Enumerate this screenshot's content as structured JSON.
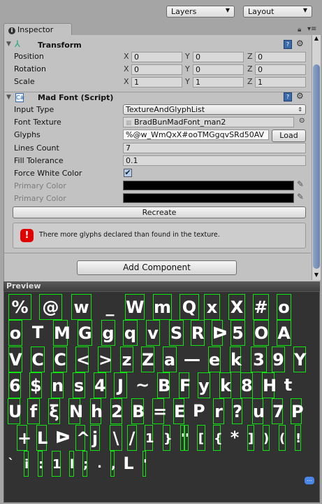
{
  "toolbar": {
    "layers": "Layers",
    "layout": "Layout"
  },
  "tab": {
    "label": "Inspector",
    "icon": "info-icon"
  },
  "transform": {
    "title": "Transform",
    "rows": [
      {
        "label": "Position",
        "x": "0",
        "y": "0",
        "z": "0"
      },
      {
        "label": "Rotation",
        "x": "0",
        "y": "0",
        "z": "0"
      },
      {
        "label": "Scale",
        "x": "1",
        "y": "1",
        "z": "1"
      }
    ],
    "axes": {
      "x": "X",
      "y": "Y",
      "z": "Z"
    }
  },
  "madfont": {
    "title": "Mad Font (Script)",
    "input_type": {
      "label": "Input Type",
      "value": "TextureAndGlyphList"
    },
    "font_texture": {
      "label": "Font Texture",
      "value": "BradBunMadFont_man2"
    },
    "glyphs": {
      "label": "Glyphs",
      "value": "%@w_WmQxX#ooTMGgqvSRd50AV",
      "load": "Load"
    },
    "lines_count": {
      "label": "Lines Count",
      "value": "7"
    },
    "fill_tolerance": {
      "label": "Fill Tolerance",
      "value": "0.1"
    },
    "force_white": {
      "label": "Force White Color",
      "checked": true
    },
    "primary_color_1": {
      "label": "Primary Color",
      "value": "#000000"
    },
    "primary_color_2": {
      "label": "Primary Color",
      "value": "#000000"
    },
    "recreate": "Recreate",
    "error": "There more glyphs declared than found in the texture."
  },
  "add_component": "Add Component",
  "preview": {
    "title": "Preview",
    "rows": [
      [
        "%",
        "@",
        "w",
        "_",
        "W",
        "m",
        "Q",
        "x",
        "X",
        "#",
        "o"
      ],
      [
        "o",
        "T",
        "M",
        "G",
        "g",
        "q",
        "v",
        "S",
        "R",
        "ᐅ",
        "5",
        "O",
        "A"
      ],
      [
        "V",
        "C",
        "C",
        "<",
        ">",
        "z",
        "Z",
        "a",
        "—",
        "e",
        "k",
        "3",
        "9",
        "Y"
      ],
      [
        "6",
        "$",
        "n",
        "s",
        "4",
        "J",
        "~",
        "B",
        "F",
        "y",
        "k",
        "8",
        "H",
        "t"
      ],
      [
        "U",
        "f",
        "ξ",
        "N",
        "h",
        "2",
        "B",
        "=",
        "E",
        "P",
        "r",
        "?",
        "u",
        "7",
        "P"
      ],
      [
        "+",
        "L",
        "ᐅ",
        "^",
        "j",
        "\\",
        "/",
        "1",
        "}",
        "'",
        "'",
        "[",
        "{",
        "*",
        "]",
        ")",
        "(",
        "!"
      ],
      [
        "`",
        "i",
        ":",
        "1",
        "l",
        ";",
        ".",
        ",",
        "L",
        "'"
      ]
    ]
  },
  "colors": {
    "panel": "#c2c2c2",
    "preview_bg": "#323232",
    "glyph_box": "#12e612",
    "error": "#e00000"
  }
}
